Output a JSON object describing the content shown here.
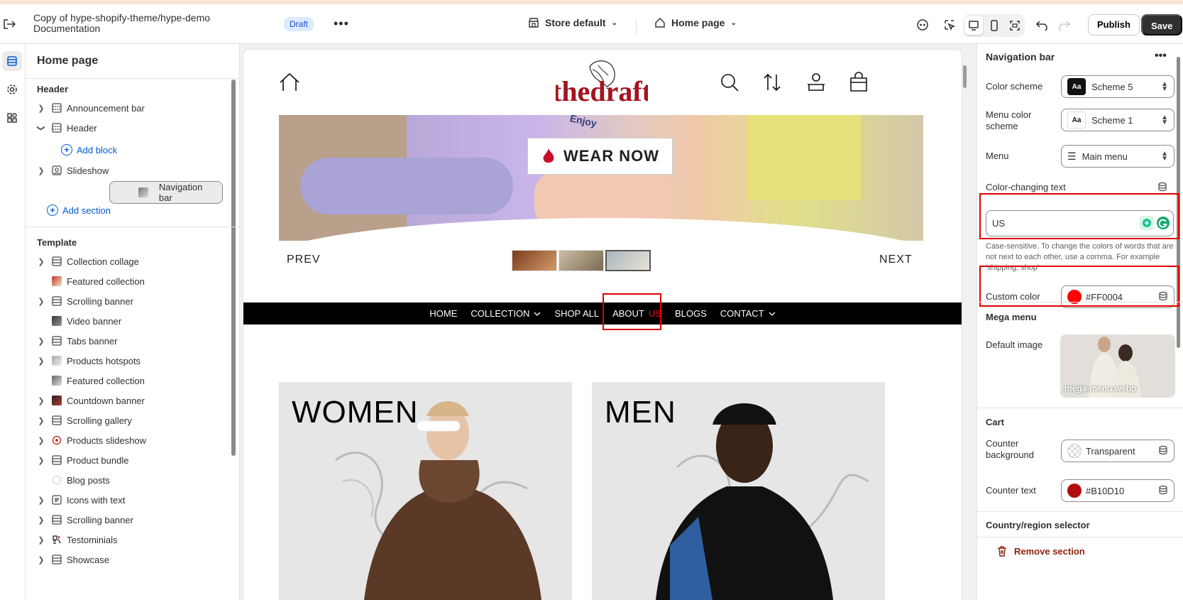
{
  "topbar": {
    "store_title": "Copy of hype-shopify-theme/hype-demo Documentation",
    "status_badge": "Draft",
    "store_selector": "Store default",
    "page_selector": "Home page",
    "publish_label": "Publish",
    "save_label": "Save"
  },
  "sidebar": {
    "title": "Home page",
    "header_group": "Header",
    "header_items": [
      {
        "label": "Announcement bar"
      },
      {
        "label": "Header"
      },
      {
        "label": "Slideshow"
      },
      {
        "label": "Navigation bar"
      }
    ],
    "add_block": "Add block",
    "add_section": "Add section",
    "template_group": "Template",
    "template_items": [
      {
        "label": "Collection collage"
      },
      {
        "label": "Featured collection"
      },
      {
        "label": "Scrolling banner"
      },
      {
        "label": "Video banner"
      },
      {
        "label": "Tabs banner"
      },
      {
        "label": "Products hotspots"
      },
      {
        "label": "Featured collection"
      },
      {
        "label": "Countdown banner"
      },
      {
        "label": "Scrolling gallery"
      },
      {
        "label": "Products slideshow"
      },
      {
        "label": "Product bundle"
      },
      {
        "label": "Blog posts"
      },
      {
        "label": "Icons with text"
      },
      {
        "label": "Scrolling banner"
      },
      {
        "label": "Testominials"
      },
      {
        "label": "Showcase"
      }
    ]
  },
  "preview": {
    "logo_text": "thedraft",
    "hero_badge": "WEAR NOW",
    "hero_shirt_text": "Enjoy",
    "prev_label": "PREV",
    "next_label": "NEXT",
    "nav": {
      "home": "HOME",
      "collection": "COLLECTION",
      "shop_all": "SHOP ALL",
      "about": "ABOUT",
      "about_highlight": "US",
      "blogs": "BLOGS",
      "contact": "CONTACT"
    },
    "card_women": "WOMEN",
    "card_men": "MEN"
  },
  "settings": {
    "title": "Navigation bar",
    "color_scheme_label": "Color scheme",
    "color_scheme_value": "Scheme 5",
    "menu_color_scheme_label": "Menu color scheme",
    "menu_color_scheme_value": "Scheme 1",
    "menu_label": "Menu",
    "menu_value": "Main menu",
    "color_changing_label": "Color-changing text",
    "color_changing_value": "US",
    "color_changing_help": "Case-sensitive. To change the colors of words that are not next to each other, use a comma. For example 'shipping, shop'",
    "custom_color_label": "Custom color",
    "custom_color_value": "#FF0004",
    "mega_menu_heading": "Mega menu",
    "default_image_label": "Default image",
    "default_image_name": "mega-menu.webp",
    "cart_heading": "Cart",
    "counter_bg_label": "Counter background",
    "counter_bg_value": "Transparent",
    "counter_text_label": "Counter text",
    "counter_text_value": "#B10D10",
    "country_heading": "Country/region selector",
    "remove_label": "Remove section"
  },
  "colors": {
    "custom": "#FF0004",
    "counter_text": "#B10D10",
    "accent": "#005bd3",
    "highlight_box": "#e00000"
  }
}
